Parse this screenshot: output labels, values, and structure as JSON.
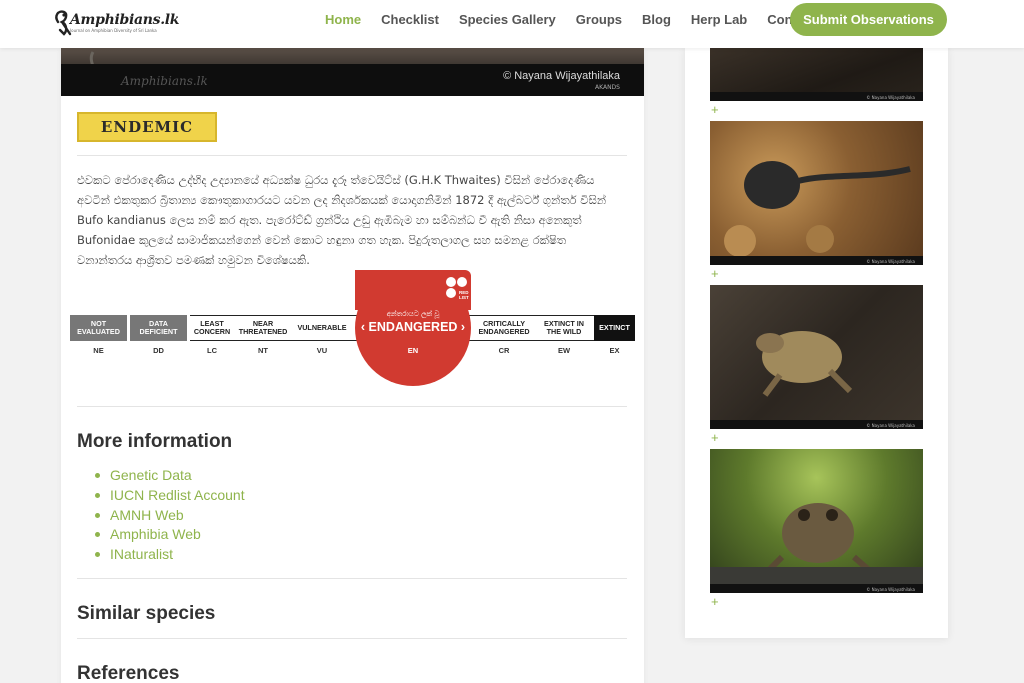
{
  "header": {
    "logo_text": "Amphibians.lk",
    "logo_tagline": "Journal on Amphibian Diversity of Sri Lanka",
    "nav": [
      {
        "label": "Home",
        "active": true
      },
      {
        "label": "Checklist",
        "active": false
      },
      {
        "label": "Species Gallery",
        "active": false
      },
      {
        "label": "Groups",
        "active": false
      },
      {
        "label": "Blog",
        "active": false
      },
      {
        "label": "Herp Lab",
        "active": false
      },
      {
        "label": "Contact",
        "active": false
      }
    ],
    "submit_label": "Submit Observations"
  },
  "hero": {
    "watermark": "Amphibians.lk",
    "credit": "© Nayana Wijayathilaka",
    "code": "AKANDS"
  },
  "badge": "ENDEMIC",
  "description": "එවකට පේරාදෙණිය උද්භිද උද්‍යානයේ අධ්‍යක්ෂ ධුරය දැරූ ත්වෙයිට්ස් (G.H.K Thwaites) විසින් පේරාදෙණිය අවටින් එකතුකර බ්‍රිතාන්‍ය කෞතුකාගාරයට යවන ලද නිදර්ශකයක් යොදාගනිමින් 1872 දී ඇල්බර්ට් ගුන්තර් විසින් Bufo kandianus ලෙස නම් කර ඇත. පැරෝට්ඩ් ග්‍රන්ථිය උඩු ඇඹිබැම හා සම්බන්ධ වී ඇති නිසා අනෙකුත් Bufonidae කුලයේ සාමාජිකයන්ගෙන් වෙන් කොට හඳුනා ගත හැක. පිදුරුතලාගල සහ සමනළ රක්ෂිත වනාන්තරය ආශ්‍රිතව පමණක් හමුවන විශේෂයකි.",
  "redlist": {
    "categories": [
      {
        "label": "NOT EVALUATED",
        "code": "NE"
      },
      {
        "label": "DATA DEFICIENT",
        "code": "DD"
      },
      {
        "label": "LEAST CONCERN",
        "code": "LC"
      },
      {
        "label": "NEAR THREATENED",
        "code": "NT"
      },
      {
        "label": "VULNERABLE",
        "code": "VU"
      },
      {
        "label": "ENDANGERED",
        "code": "EN"
      },
      {
        "label": "CRITICALLY ENDANGERED",
        "code": "CR"
      },
      {
        "label": "EXTINCT IN THE WILD",
        "code": "EW"
      },
      {
        "label": "EXTINCT",
        "code": "EX"
      }
    ],
    "selected_top_text": "අන්තරායට ලක් වූ",
    "selected_label": "ENDANGERED",
    "selected_code": "EN",
    "logo_text": "RED LIST",
    "accent": "#d13a30"
  },
  "more_info": {
    "title": "More information",
    "links": [
      "Genetic Data",
      "IUCN Redlist Account",
      "AMNH Web",
      "Amphibia Web",
      "INaturalist"
    ]
  },
  "similar": {
    "title": "Similar species"
  },
  "references": {
    "title": "References"
  },
  "sidebar": {
    "photo_credit": "© Nayana Wijayathilaka",
    "plus": "+"
  },
  "colors": {
    "accent": "#8fb44c",
    "endemic_bg": "#f0d34a"
  }
}
